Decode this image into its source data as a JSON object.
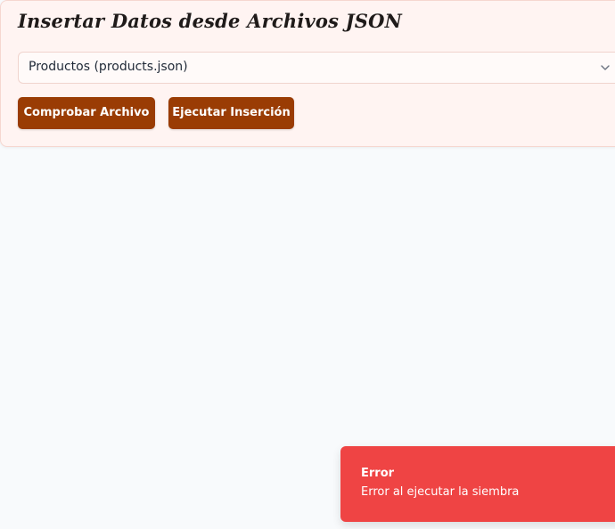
{
  "header": {
    "title": "Insertar Datos desde Archivos JSON"
  },
  "file_select": {
    "selected": "Productos (products.json)"
  },
  "actions": {
    "check_label": "Comprobar Archivo",
    "run_label": "Ejecutar Inserción"
  },
  "toast": {
    "title": "Error",
    "message": "Error al ejecutar la siembra"
  },
  "colors": {
    "primary_button": "#9a3c04",
    "card_background": "#fff4f2",
    "page_background": "#f8fafc",
    "error_toast": "#ef4444"
  }
}
